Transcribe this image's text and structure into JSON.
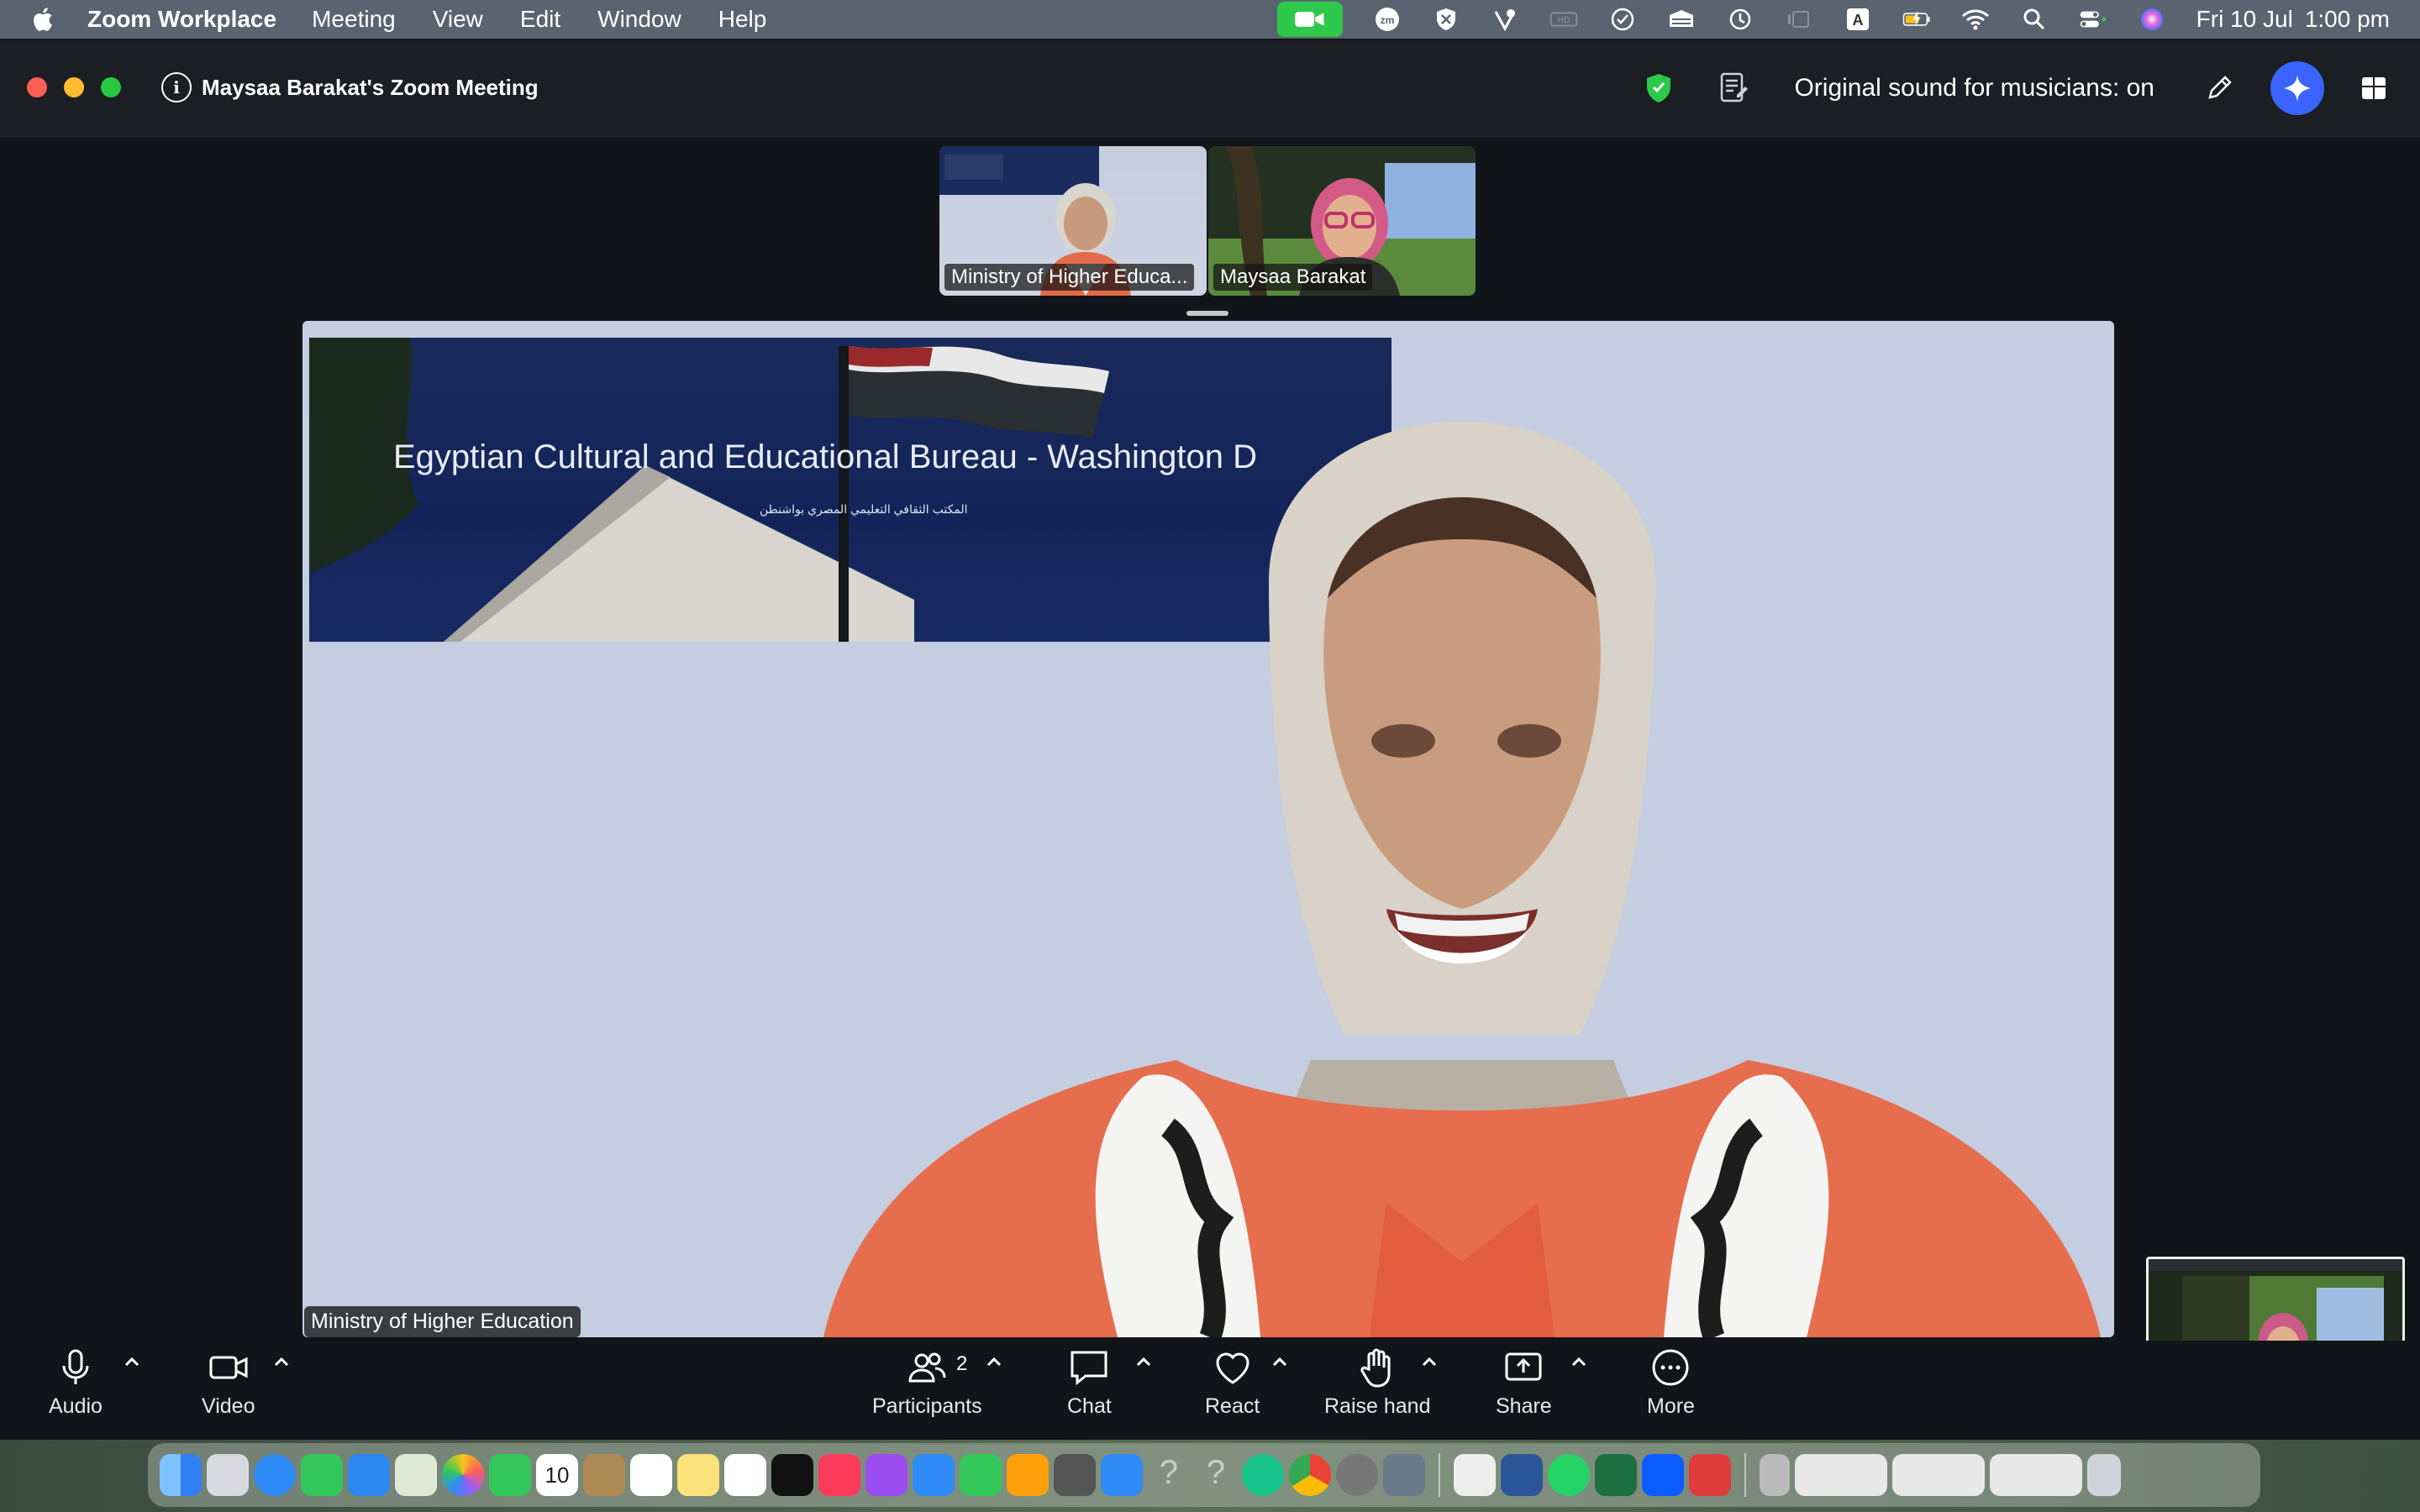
{
  "menubar": {
    "app_name": "Zoom Workplace",
    "menus": [
      "Meeting",
      "View",
      "Edit",
      "Window",
      "Help"
    ],
    "date": "Fri 10 Jul",
    "time": "1:00 pm"
  },
  "window": {
    "meeting_title": "Maysaa Barakat's Zoom Meeting",
    "sound_status": "Original sound for musicians: on"
  },
  "thumbnails": [
    {
      "name": "Ministry of Higher Educa..."
    },
    {
      "name": "Maysaa Barakat"
    }
  ],
  "main_video": {
    "speaker_label": "Ministry of Higher Education",
    "banner_title": "Egyptian Cultural and Educational Bureau - Washington D",
    "banner_subtitle": "المكتب الثقافي التعليمي المصري بواشنطن"
  },
  "toolbar": {
    "audio": "Audio",
    "video": "Video",
    "participants": "Participants",
    "participants_count": "2",
    "chat": "Chat",
    "react": "React",
    "raise_hand": "Raise hand",
    "share": "Share",
    "more": "More"
  },
  "dock": {
    "calendar_day": "10"
  },
  "colors": {
    "menubar_bg": "#5a6470",
    "window_bg": "#111418",
    "zoom_green": "#2ec84a",
    "ai_blue": "#3a63ff",
    "main_bg": "#c5cde0"
  }
}
